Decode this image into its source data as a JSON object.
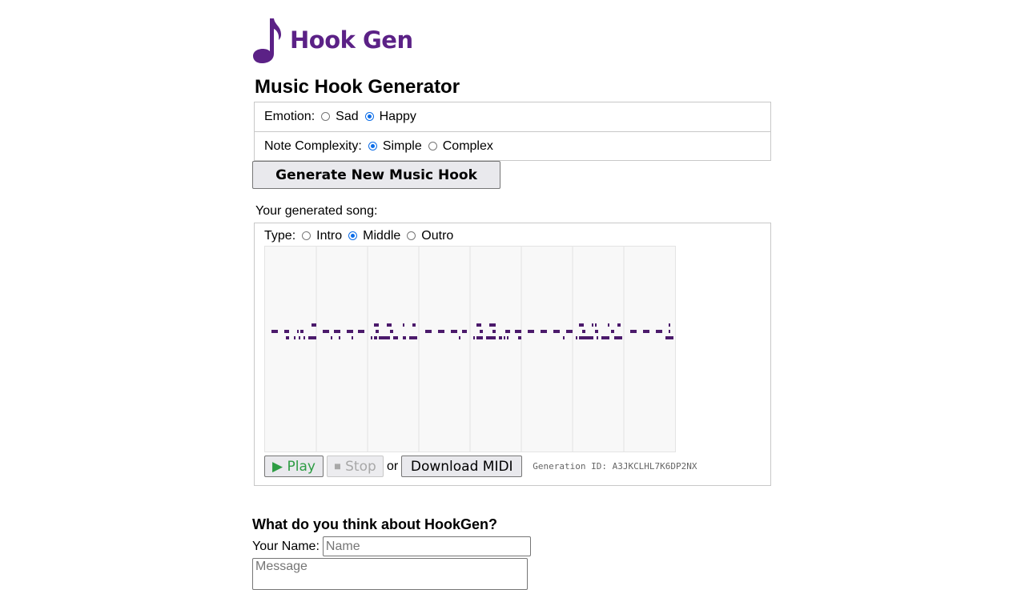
{
  "logo": {
    "text": "Hook Gen",
    "icon": "music-note-icon",
    "color": "#5b2186"
  },
  "page_title": "Music Hook Generator",
  "emotion": {
    "label": "Emotion:",
    "options": [
      "Sad",
      "Happy"
    ],
    "selected": "Happy"
  },
  "complexity": {
    "label": "Note Complexity:",
    "options": [
      "Simple",
      "Complex"
    ],
    "selected": "Simple"
  },
  "generate_button": "Generate New Music Hook",
  "song": {
    "label": "Your generated song:",
    "type_label": "Type:",
    "type_options": [
      "Intro",
      "Middle",
      "Outro"
    ],
    "type_selected": "Middle",
    "measures": 8,
    "note_color": "#4b1a6b"
  },
  "controls": {
    "play": "▶ Play",
    "stop": "⏹ Stop",
    "or": "or",
    "download": "Download MIDI",
    "generation_id": "Generation ID: A3JKCLHL7K6DP2NX"
  },
  "feedback": {
    "title": "What do you think about HookGen?",
    "name_label": "Your Name:",
    "name_placeholder": "Name",
    "message_placeholder": "Message"
  }
}
